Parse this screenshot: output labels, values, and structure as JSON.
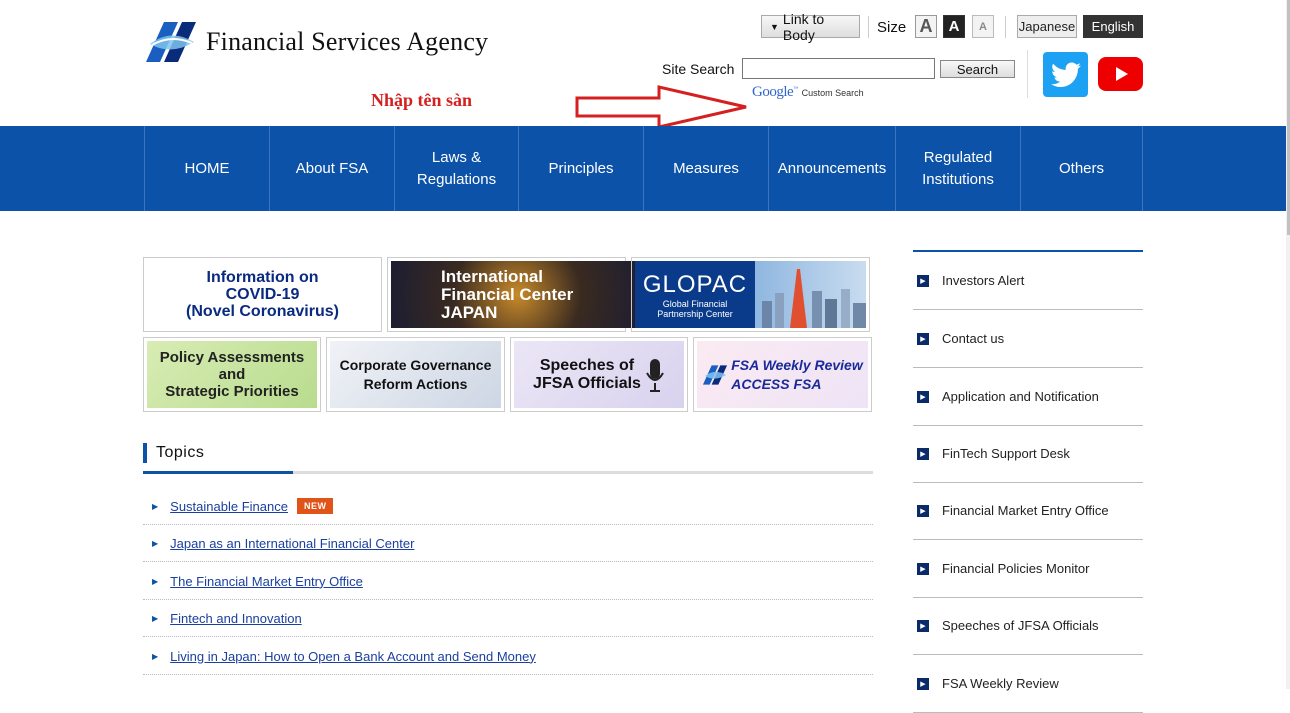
{
  "header": {
    "logo_text": "Financial Services Agency",
    "link_to_body": "Link to Body",
    "size_label": "Size",
    "size_large": "A",
    "size_medium": "A",
    "size_small": "A",
    "lang_japanese": "Japanese",
    "lang_english": "English",
    "search_label": "Site Search",
    "search_value": "",
    "search_button": "Search",
    "google_brand": "Google",
    "custom_search": "Custom Search",
    "annotation": "Nhập tên sàn",
    "colors": {
      "brand_blue": "#0b52a8",
      "twitter": "#1da1f2",
      "youtube": "#ee0000",
      "annotation_red": "#d42020"
    }
  },
  "nav": {
    "items": [
      {
        "label": "HOME"
      },
      {
        "label": "About FSA"
      },
      {
        "label": "Laws &\nRegulations"
      },
      {
        "label": "Principles"
      },
      {
        "label": "Measures"
      },
      {
        "label": "Announcements"
      },
      {
        "label": "Regulated\nInstitutions"
      },
      {
        "label": "Others"
      }
    ]
  },
  "banners": {
    "covid": "Information on\nCOVID-19\n(Novel Coronavirus)",
    "ifc": "International\nFinancial Center\nJAPAN",
    "glopac_title": "GLOPAC",
    "glopac_sub": "Global Financial\nPartnership Center",
    "policy": "Policy Assessments\nand\nStrategic Priorities",
    "corp": "Corporate Governance\nReform Actions",
    "speech": "Speeches of\nJFSA Officials",
    "weekly": "FSA Weekly Review\nACCESS FSA"
  },
  "topics": {
    "title": "Topics",
    "new_badge": "NEW",
    "items": [
      {
        "label": "Sustainable Finance"
      },
      {
        "label": "Japan as an International Financial Center"
      },
      {
        "label": "The Financial Market Entry Office"
      },
      {
        "label": "Fintech and Innovation"
      },
      {
        "label": "Living in Japan: How to Open a Bank Account and Send Money"
      }
    ]
  },
  "side_links": [
    {
      "label": "Investors Alert"
    },
    {
      "label": "Contact us"
    },
    {
      "label": "Application and Notification"
    },
    {
      "label": "FinTech Support Desk"
    },
    {
      "label": "Financial Market Entry Office"
    },
    {
      "label": "Financial Policies Monitor"
    },
    {
      "label": "Speeches of JFSA Officials"
    },
    {
      "label": "FSA Weekly Review"
    }
  ]
}
